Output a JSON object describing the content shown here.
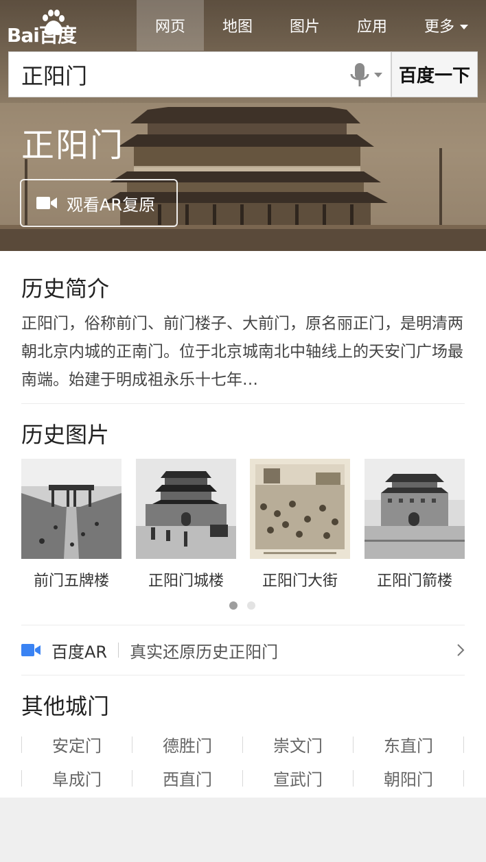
{
  "header": {
    "logo_text": "Bai百度",
    "nav": [
      {
        "label": "网页",
        "active": true
      },
      {
        "label": "地图",
        "active": false
      },
      {
        "label": "图片",
        "active": false
      },
      {
        "label": "应用",
        "active": false
      },
      {
        "label": "更多",
        "active": false
      }
    ]
  },
  "search": {
    "value": "正阳门",
    "button_label": "百度一下",
    "mic_icon": "microphone-icon"
  },
  "hero": {
    "title": "正阳门",
    "ar_button_label": "观看AR复原",
    "ar_icon": "video-camera-icon"
  },
  "history": {
    "title": "历史简介",
    "text": "正阳门，俗称前门、前门楼子、大前门，原名丽正门，是明清两朝北京内城的正南门。位于北京城南北中轴线上的天安门广场最南端。始建于明成祖永乐十七年…"
  },
  "photos": {
    "title": "历史图片",
    "items": [
      {
        "caption": "前门五牌楼"
      },
      {
        "caption": "正阳门城楼"
      },
      {
        "caption": "正阳门大街"
      },
      {
        "caption": "正阳门箭楼"
      }
    ],
    "page_count": 2,
    "current_page": 1
  },
  "ar_promo": {
    "brand": "百度AR",
    "text": "真实还原历史正阳门",
    "icon": "video-camera-icon"
  },
  "other_gates": {
    "title": "其他城门",
    "rows": [
      [
        "安定门",
        "德胜门",
        "崇文门",
        "东直门"
      ],
      [
        "阜成门",
        "西直门",
        "宣武门",
        "朝阳门"
      ]
    ]
  },
  "colors": {
    "accent_blue": "#3a83f3",
    "hero_sepia": "#95836c"
  }
}
